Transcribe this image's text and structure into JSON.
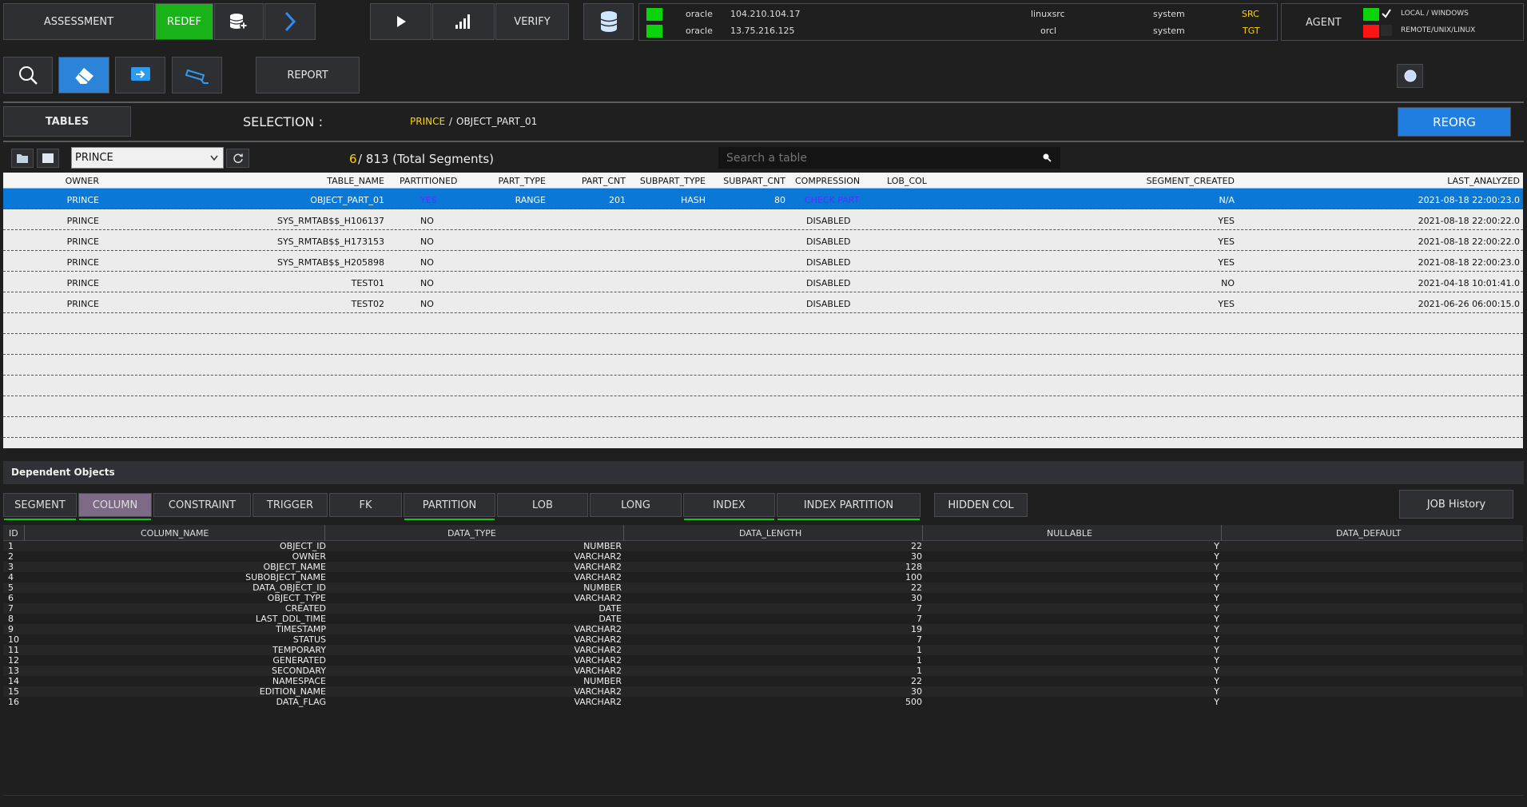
{
  "toolbar": {
    "assessment_label": "ASSESSMENT",
    "redef_label": "REDEF",
    "verify_label": "VERIFY",
    "report_label": "REPORT",
    "agent_label": "AGENT",
    "reorg_label": "REORG",
    "job_history_label": "JOB History",
    "hidden_col_label": "HIDDEN COL"
  },
  "connections": [
    {
      "db": "oracle",
      "ip": "104.210.104.17",
      "name": "linuxsrc",
      "user": "system",
      "role": "SRC",
      "status_color": "#0bd40b"
    },
    {
      "db": "oracle",
      "ip": "13.75.216.125",
      "name": "orcl",
      "user": "system",
      "role": "TGT",
      "status_color": "#0bd40b"
    }
  ],
  "agent": {
    "local_label": "LOCAL / WINDOWS",
    "remote_label": "REMOTE/UNIX/LINUX",
    "local_checked": true
  },
  "selection": {
    "tables_label": "TABLES",
    "selection_label": "SELECTION :",
    "owner": "PRINCE",
    "slash": "/",
    "table": "OBJECT_PART_01"
  },
  "filter": {
    "schema_value": "PRINCE",
    "count": "6",
    "total_text": " / 813 (Total Segments)",
    "search_placeholder": "Search a table"
  },
  "main_table": {
    "columns": [
      "OWNER",
      "TABLE_NAME",
      "PARTITIONED",
      "PART_TYPE",
      "PART_CNT",
      "SUBPART_TYPE",
      "SUBPART_CNT",
      "COMPRESSION",
      "LOB_COL",
      "SEGMENT_CREATED",
      "LAST_ANALYZED"
    ],
    "rows": [
      {
        "owner": "PRINCE",
        "table_name": "OBJECT_PART_01",
        "partitioned": "YES",
        "part_type": "RANGE",
        "part_cnt": "201",
        "subpart_type": "HASH",
        "subpart_cnt": "80",
        "compression": "CHECK PART",
        "lob_col": "",
        "segment_created": "N/A",
        "last_analyzed": "2021-08-18 22:00:23.0"
      },
      {
        "owner": "PRINCE",
        "table_name": "SYS_RMTAB$$_H106137",
        "partitioned": "NO",
        "part_type": "",
        "part_cnt": "",
        "subpart_type": "",
        "subpart_cnt": "",
        "compression": "DISABLED",
        "lob_col": "",
        "segment_created": "YES",
        "last_analyzed": "2021-08-18 22:00:22.0"
      },
      {
        "owner": "PRINCE",
        "table_name": "SYS_RMTAB$$_H173153",
        "partitioned": "NO",
        "part_type": "",
        "part_cnt": "",
        "subpart_type": "",
        "subpart_cnt": "",
        "compression": "DISABLED",
        "lob_col": "",
        "segment_created": "YES",
        "last_analyzed": "2021-08-18 22:00:22.0"
      },
      {
        "owner": "PRINCE",
        "table_name": "SYS_RMTAB$$_H205898",
        "partitioned": "NO",
        "part_type": "",
        "part_cnt": "",
        "subpart_type": "",
        "subpart_cnt": "",
        "compression": "DISABLED",
        "lob_col": "",
        "segment_created": "YES",
        "last_analyzed": "2021-08-18 22:00:23.0"
      },
      {
        "owner": "PRINCE",
        "table_name": "TEST01",
        "partitioned": "NO",
        "part_type": "",
        "part_cnt": "",
        "subpart_type": "",
        "subpart_cnt": "",
        "compression": "DISABLED",
        "lob_col": "",
        "segment_created": "NO",
        "last_analyzed": "2021-04-18 10:01:41.0"
      },
      {
        "owner": "PRINCE",
        "table_name": "TEST02",
        "partitioned": "NO",
        "part_type": "",
        "part_cnt": "",
        "subpart_type": "",
        "subpart_cnt": "",
        "compression": "DISABLED",
        "lob_col": "",
        "segment_created": "YES",
        "last_analyzed": "2021-06-26 06:00:15.0"
      }
    ]
  },
  "dependent": {
    "title": "Dependent Objects",
    "tabs": [
      "SEGMENT",
      "COLUMN",
      "CONSTRAINT",
      "TRIGGER",
      "FK",
      "PARTITION",
      "LOB",
      "LONG",
      "INDEX",
      "INDEX PARTITION"
    ],
    "active_tab": "COLUMN"
  },
  "column_table": {
    "columns": [
      "ID",
      "COLUMN_NAME",
      "DATA_TYPE",
      "DATA_LENGTH",
      "NULLABLE",
      "DATA_DEFAULT"
    ],
    "rows": [
      [
        "1",
        "OBJECT_ID",
        "NUMBER",
        "22",
        "Y",
        ""
      ],
      [
        "2",
        "OWNER",
        "VARCHAR2",
        "30",
        "Y",
        ""
      ],
      [
        "3",
        "OBJECT_NAME",
        "VARCHAR2",
        "128",
        "Y",
        ""
      ],
      [
        "4",
        "SUBOBJECT_NAME",
        "VARCHAR2",
        "100",
        "Y",
        ""
      ],
      [
        "5",
        "DATA_OBJECT_ID",
        "NUMBER",
        "22",
        "Y",
        ""
      ],
      [
        "6",
        "OBJECT_TYPE",
        "VARCHAR2",
        "30",
        "Y",
        ""
      ],
      [
        "7",
        "CREATED",
        "DATE",
        "7",
        "Y",
        ""
      ],
      [
        "8",
        "LAST_DDL_TIME",
        "DATE",
        "7",
        "Y",
        ""
      ],
      [
        "9",
        "TIMESTAMP",
        "VARCHAR2",
        "19",
        "Y",
        ""
      ],
      [
        "10",
        "STATUS",
        "VARCHAR2",
        "7",
        "Y",
        ""
      ],
      [
        "11",
        "TEMPORARY",
        "VARCHAR2",
        "1",
        "Y",
        ""
      ],
      [
        "12",
        "GENERATED",
        "VARCHAR2",
        "1",
        "Y",
        ""
      ],
      [
        "13",
        "SECONDARY",
        "VARCHAR2",
        "1",
        "Y",
        ""
      ],
      [
        "14",
        "NAMESPACE",
        "NUMBER",
        "22",
        "Y",
        ""
      ],
      [
        "15",
        "EDITION_NAME",
        "VARCHAR2",
        "30",
        "Y",
        ""
      ],
      [
        "16",
        "DATA_FLAG",
        "VARCHAR2",
        "500",
        "Y",
        ""
      ]
    ]
  },
  "icons": {
    "add_db": "database-plus-icon",
    "next": "chevron-right-icon",
    "run": "play-icon",
    "stats": "signal-bars-icon",
    "db": "database-icon",
    "search": "search-icon",
    "eraser": "eraser-icon",
    "export": "export-icon",
    "camera": "cctv-camera-icon",
    "settings": "circle-icon",
    "folder": "folder-icon",
    "grid": "grid-icon",
    "refresh": "refresh-icon"
  }
}
